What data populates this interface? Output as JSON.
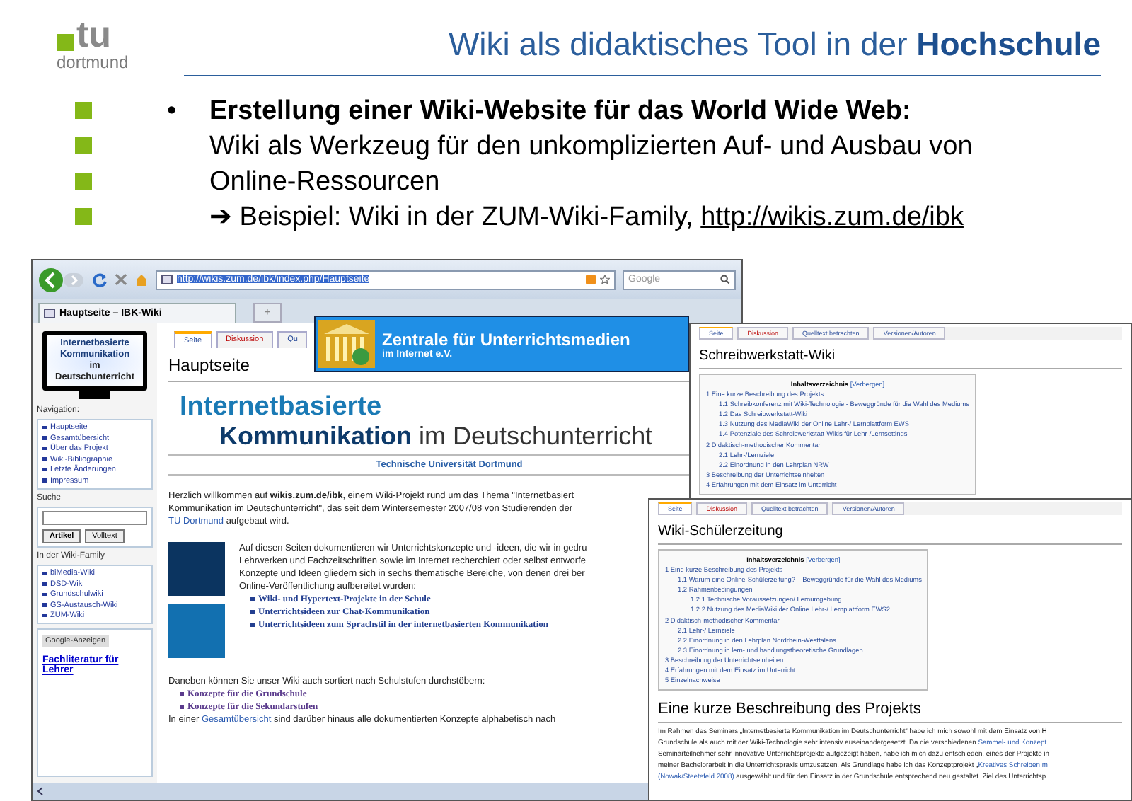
{
  "slide": {
    "logo": {
      "mark": "tu",
      "wordmark": "dortmund"
    },
    "title": "Wiki als didaktisches Tool in der **Hochschule**",
    "bullet": {
      "mark": "•",
      "heading": "Erstellung einer Wiki-Website für das World Wide Web:",
      "text": "Wiki als Werkzeug für den unkomplizierten Auf- und Ausbau von Online-Ressourcen",
      "arrow": "➔",
      "example": "Beispiel: Wiki in der ZUM-Wiki-Family,",
      "link": "http://wikis.zum.de/ibk"
    }
  },
  "browser": {
    "url": "http://wikis.zum.de/ibk/index.php/Hauptseite",
    "search_placeholder": "Google",
    "tab": "Hauptseite – IBK-Wiki",
    "new_tab": "+",
    "sidebar": {
      "logo_lines": [
        "Internetbasierte",
        "Kommunikation",
        "im",
        "Deutschunterricht"
      ],
      "navigation": {
        "heading": "Navigation:",
        "items": [
          "Hauptseite",
          "Gesamtübersicht",
          "Über das Projekt",
          "Wiki-Bibliographie",
          "Letzte Änderungen",
          "Impressum"
        ]
      },
      "search": {
        "heading": "Suche",
        "buttons": [
          "Artikel",
          "Volltext"
        ]
      },
      "family": {
        "heading": "In der Wiki-Family",
        "items": [
          "biMedia-Wiki",
          "DSD-Wiki",
          "Grundschulwiki",
          "GS-Austausch-Wiki",
          "ZUM-Wiki"
        ]
      },
      "ads": {
        "label": "Google-Anzeigen",
        "link": "Fachliteratur für Lehrer"
      }
    },
    "page": {
      "tabs": [
        {
          "label": "Seite",
          "selected": true,
          "missing": false
        },
        {
          "label": "Diskussion",
          "selected": false,
          "missing": true
        },
        {
          "label": "Qu",
          "selected": false,
          "missing": false
        }
      ],
      "title": "Hauptseite",
      "logo": {
        "line1": "Internetbasierte",
        "line2": "**Kommunikation** im Deutschunterricht",
        "subline": "Technische Universität Dortmund"
      },
      "intro": [
        [
          {
            "kind": "plain",
            "text": "Herzlich willkommen auf "
          },
          {
            "kind": "bold",
            "text": "wikis.zum.de/ibk"
          },
          {
            "kind": "plain",
            "text": ", einem Wiki-Projekt rund um das Thema \"Internetbasiert"
          }
        ],
        [
          {
            "kind": "plain",
            "text": "Kommunikation im Deutschunterricht\", das seit dem Wintersemester 2007/08 von Studierenden der"
          }
        ],
        [
          {
            "kind": "link",
            "text": "TU Dortmund"
          },
          {
            "kind": "plain",
            "text": " aufgebaut wird."
          }
        ]
      ],
      "topics": {
        "lines": [
          "Auf diesen Seiten dokumentieren wir Unterrichtskonzepte und -ideen, die wir in gedru",
          "Lehrwerken und Fachzeitschriften sowie im Internet recherchiert oder selbst entworfe",
          "Konzepte und Ideen gliedern sich in sechs thematische Bereiche, von denen drei ber",
          "Online-Veröffentlichung aufbereitet wurden:"
        ],
        "links": [
          "Wiki- und Hypertext-Projekte in der Schule",
          "Unterrichtsideen zur Chat-Kommunikation",
          "Unterrichtsideen zum Sprachstil in der internetbasierten Kommunikation"
        ]
      },
      "levels": {
        "text": "Daneben können Sie unser Wiki auch sortiert nach Schulstufen durchstöbern:",
        "links": [
          "Konzepte für die Grundschule",
          "Konzepte für die Sekundarstufen"
        ]
      },
      "overview": [
        {
          "kind": "plain",
          "text": "In einer "
        },
        {
          "kind": "link",
          "text": "Gesamtübersicht"
        },
        {
          "kind": "plain",
          "text": " sind darüber hinaus alle dokumentierten Konzepte alphabetisch nach"
        }
      ]
    },
    "banner": {
      "title": "Zentrale für Unterrichtsmedien",
      "subtitle": "im Internet e.V."
    }
  },
  "windows": [
    {
      "tabs": [
        {
          "label": "Seite",
          "selected": true,
          "missing": false
        },
        {
          "label": "Diskussion",
          "selected": false,
          "missing": true
        },
        {
          "label": "Quelltext betrachten",
          "selected": false,
          "missing": false
        },
        {
          "label": "Versionen/Autoren",
          "selected": false,
          "missing": false
        }
      ],
      "title": "Schreibwerkstatt-Wiki",
      "toc": {
        "heading": "Inhaltsverzeichnis",
        "toggle": "[Verbergen]",
        "items": [
          {
            "number": "1",
            "text": "Eine kurze Beschreibung des Projekts",
            "children": [
              {
                "number": "1.1",
                "text": "Schreibkonferenz mit Wiki-Technologie - Beweggründe für die Wahl des Mediums"
              },
              {
                "number": "1.2",
                "text": "Das Schreibwerkstatt-Wiki"
              },
              {
                "number": "1.3",
                "text": "Nutzung des MediaWiki der Online Lehr-/ Lernplattform EWS"
              },
              {
                "number": "1.4",
                "text": "Potenziale des Schreibwerkstatt-Wikis für Lehr-/Lernsettings"
              }
            ]
          },
          {
            "number": "2",
            "text": "Didaktisch-methodischer Kommentar",
            "children": [
              {
                "number": "2.1",
                "text": "Lehr-/Lernziele"
              },
              {
                "number": "2.2",
                "text": "Einordnung in den Lehrplan NRW"
              }
            ]
          },
          {
            "number": "3",
            "text": "Beschreibung der Unterrichtseinheiten"
          },
          {
            "number": "4",
            "text": "Erfahrungen mit dem Einsatz im Unterricht"
          }
        ]
      }
    },
    {
      "tabs": [
        {
          "label": "Seite",
          "selected": true,
          "missing": false
        },
        {
          "label": "Diskussion",
          "selected": false,
          "missing": true
        },
        {
          "label": "Quelltext betrachten",
          "selected": false,
          "missing": false
        },
        {
          "label": "Versionen/Autoren",
          "selected": false,
          "missing": false
        }
      ],
      "title": "Wiki-Schülerzeitung",
      "toc": {
        "heading": "Inhaltsverzeichnis",
        "toggle": "[Verbergen]",
        "items": [
          {
            "number": "1",
            "text": "Eine kurze Beschreibung des Projekts",
            "children": [
              {
                "number": "1.1",
                "text": "Warum eine Online-Schülerzeitung? – Beweggründe für die Wahl des Mediums"
              },
              {
                "number": "1.2",
                "text": "Rahmenbedingungen",
                "children": [
                  {
                    "number": "1.2.1",
                    "text": "Technische Voraussetzungen/ Lernumgebung"
                  },
                  {
                    "number": "1.2.2",
                    "text": "Nutzung des MediaWiki der Online Lehr-/ Lernplattform EWS2"
                  }
                ]
              }
            ]
          },
          {
            "number": "2",
            "text": "Didaktisch-methodischer Kommentar",
            "children": [
              {
                "number": "2.1",
                "text": "Lehr-/ Lernziele"
              },
              {
                "number": "2.2",
                "text": "Einordnung in den Lehrplan Nordrhein-Westfalens"
              },
              {
                "number": "2.3",
                "text": "Einordnung in lern- und handlungstheoretische Grundlagen"
              }
            ]
          },
          {
            "number": "3",
            "text": "Beschreibung der Unterrichtseinheiten"
          },
          {
            "number": "4",
            "text": "Erfahrungen mit dem Einsatz im Unterricht"
          },
          {
            "number": "5",
            "text": "Einzelnachweise"
          }
        ]
      },
      "section": {
        "heading": "Eine kurze Beschreibung des Projekts",
        "lines": [
          [
            {
              "kind": "plain",
              "text": "Im Rahmen des Seminars „Internetbasierte Kommunikation im Deutschunterricht“ habe ich mich sowohl mit dem Einsatz von H"
            }
          ],
          [
            {
              "kind": "plain",
              "text": "Grundschule als auch mit der Wiki-Technologie sehr intensiv auseinandergesetzt. Da die verschiedenen "
            },
            {
              "kind": "link",
              "text": "Sammel- und Konzept"
            }
          ],
          [
            {
              "kind": "plain",
              "text": "Seminarteilnehmer sehr innovative Unterrichtsprojekte aufgezeigt haben, habe ich mich dazu entschieden, eines der Projekte in"
            }
          ],
          [
            {
              "kind": "plain",
              "text": "meiner Bachelorarbeit in die Unterrichtspraxis umzusetzen. Als Grundlage habe ich das Konzeptprojekt „"
            },
            {
              "kind": "link",
              "text": "Kreatives Schreiben m"
            }
          ],
          [
            {
              "kind": "link",
              "text": "(Nowak/Steetefeld 2008)"
            },
            {
              "kind": "plain",
              "text": " ausgewählt und für den Einsatz in der Grundschule entsprechend neu gestaltet. Ziel des Unterrichtsp"
            }
          ]
        ]
      }
    }
  ]
}
